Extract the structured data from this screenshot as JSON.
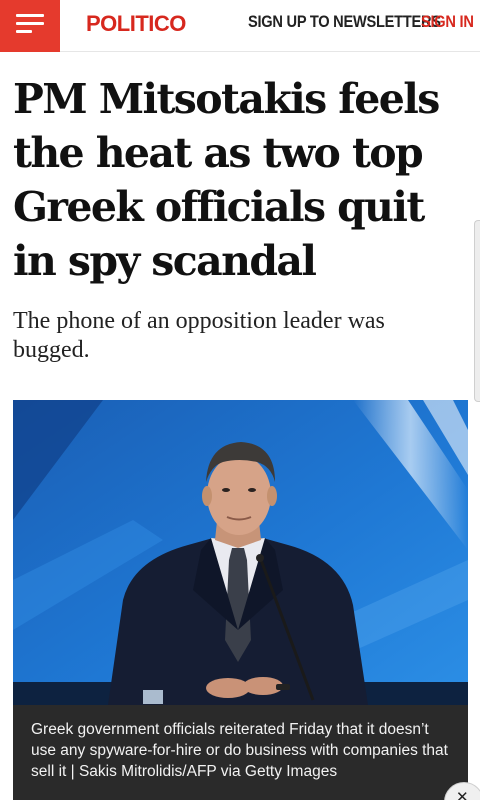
{
  "header": {
    "brand": "POLITICO",
    "newsletters_label": "SIGN UP TO NEWSLETTERS",
    "signin_label": "SIGN IN",
    "menu_icon": "hamburger-menu-icon",
    "brand_color": "#d7281e",
    "menu_bg": "#e53a2d"
  },
  "article": {
    "headline": "PM Mitsotakis feels the heat as two top Greek officials quit in spy scandal",
    "subhead": "The phone of an opposition leader was bugged.",
    "image_caption": "Greek government officials reiterated Friday that it doesn’t use any spyware-for-hire or do business with companies that sell it | Sakis Mitrolidis/AFP via Getty Images"
  },
  "controls": {
    "close_icon": "close-icon",
    "close_glyph": "✕"
  }
}
